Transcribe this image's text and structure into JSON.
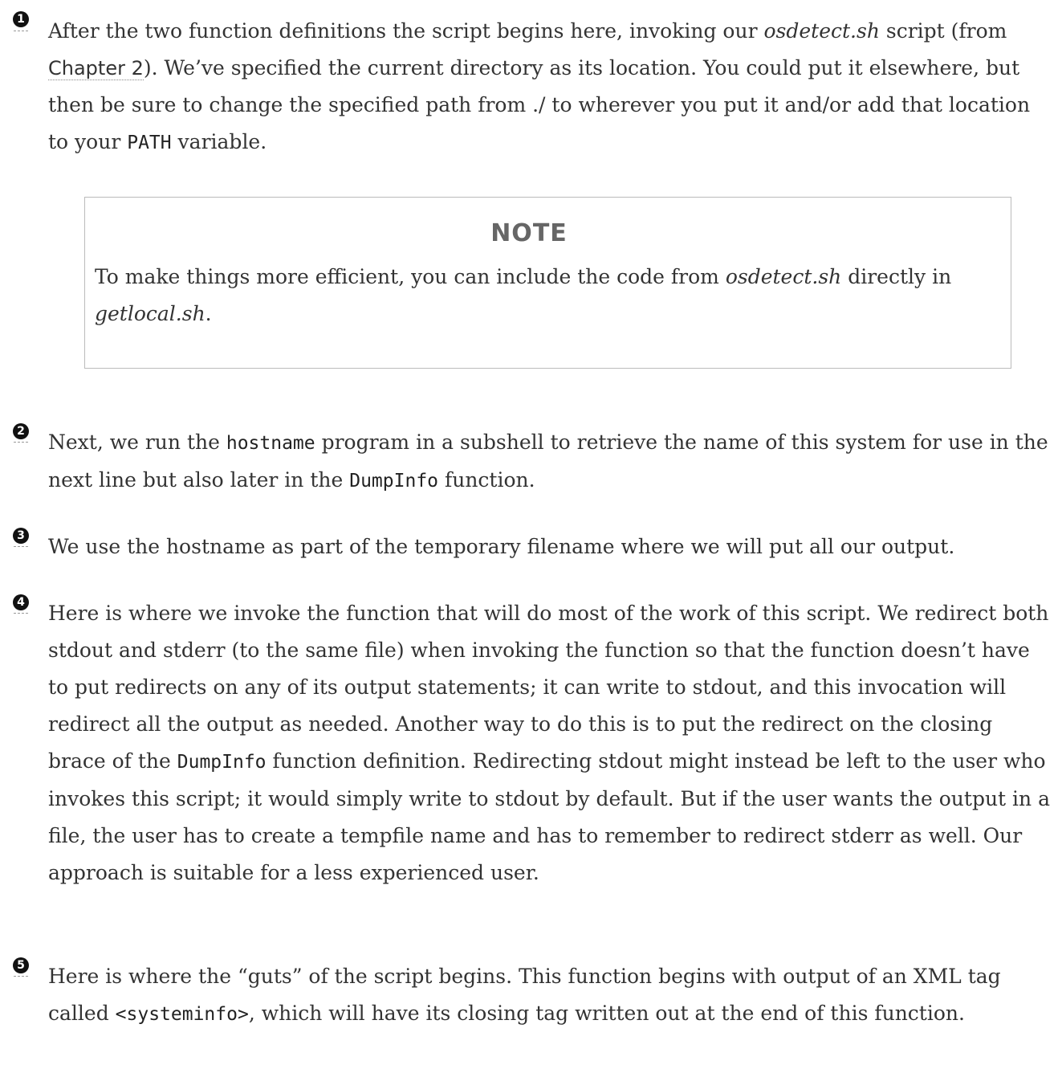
{
  "callouts": [
    {
      "number": "1",
      "parts": [
        {
          "t": "After the two function definitions the script begins here, invoking our "
        },
        {
          "t": "osdetect.sh",
          "s": "ital"
        },
        {
          "t": " script (from "
        },
        {
          "t": "Chapter 2",
          "s": "xref"
        },
        {
          "t": "). We’ve specified the current directory as its location. You could put it elsewhere, but then be sure to change the specified path from ./ to wherever you put it and/or add that location to your "
        },
        {
          "t": "PATH",
          "s": "mono"
        },
        {
          "t": " variable."
        }
      ]
    },
    {
      "number": "2",
      "parts": [
        {
          "t": "Next, we run the "
        },
        {
          "t": "hostname",
          "s": "mono"
        },
        {
          "t": " program in a subshell to retrieve the name of this system for use in the next line but also later in the "
        },
        {
          "t": "DumpInfo",
          "s": "mono"
        },
        {
          "t": " function."
        }
      ]
    },
    {
      "number": "3",
      "parts": [
        {
          "t": "We use the hostname as part of the temporary filename where we will put all our output."
        }
      ]
    },
    {
      "number": "4",
      "parts": [
        {
          "t": "Here is where we invoke the function that will do most of the work of this script. We redirect both stdout and stderr (to the same file) when invoking the function so that the function doesn’t have to put redirects on any of its output statements; it can write to stdout, and this invocation will redirect all the output as needed. Another way to do this is to put the redirect on the closing brace of the "
        },
        {
          "t": "DumpInfo",
          "s": "mono"
        },
        {
          "t": " function definition. Redirecting stdout might instead be left to the user who invokes this script; it would simply write to stdout by default. But if the user wants the output in a file, the user has to create a tempfile name and has to remember to redirect stderr as well. Our approach is suitable for a less experienced user."
        }
      ]
    },
    {
      "number": "5",
      "parts": [
        {
          "t": "Here is where the “guts” of the script begins. This function begins with output of an XML tag called "
        },
        {
          "t": "<systeminfo>",
          "s": "mono"
        },
        {
          "t": ", which will have its closing tag written out at the end of this function."
        }
      ]
    }
  ],
  "note": {
    "title": "NOTE",
    "parts": [
      {
        "t": "To make things more efficient, you can include the code from "
      },
      {
        "t": "osdetect.sh",
        "s": "ital"
      },
      {
        "t": " directly in "
      },
      {
        "t": "getlocal.sh",
        "s": "ital"
      },
      {
        "t": "."
      }
    ]
  }
}
